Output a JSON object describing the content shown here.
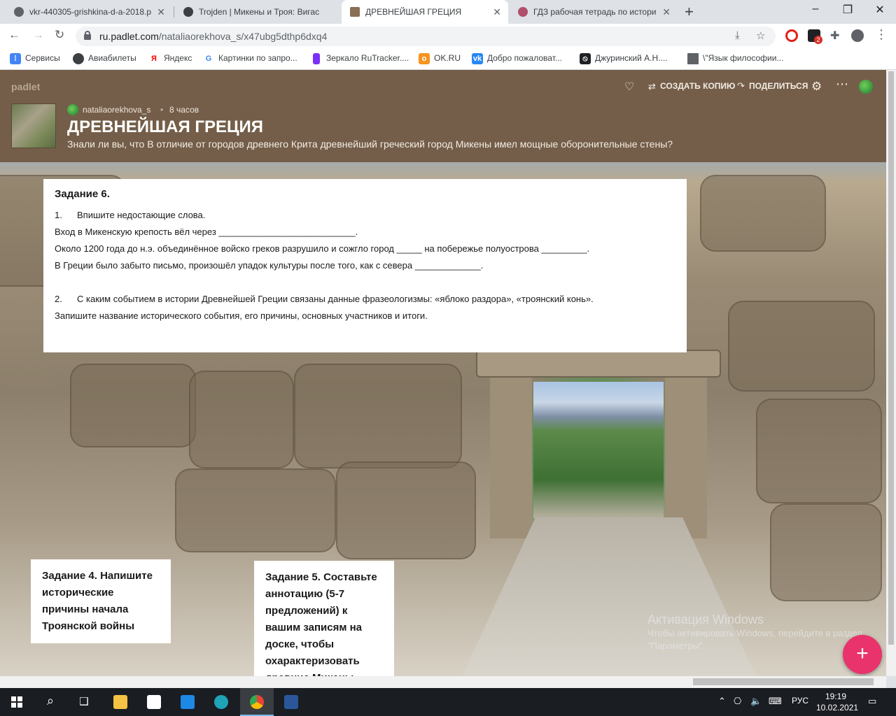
{
  "browser": {
    "tabs": [
      {
        "title": "vkr-440305-grishkina-d-a-2018.p",
        "favicon_color": "#5f6368",
        "active": false
      },
      {
        "title": "Trojden | Микены и Троя: Вигас",
        "favicon_color": "#3c4043",
        "active": false
      },
      {
        "title": "ДРЕВНЕЙШАЯ ГРЕЦИЯ",
        "favicon_color": "#8a6f55",
        "active": true
      },
      {
        "title": "ГДЗ рабочая тетрадь по истори",
        "favicon_color": "#b0506a",
        "active": false
      }
    ],
    "new_tab_glyph": "+",
    "window_controls": {
      "minimize": "–",
      "restore": "❐",
      "close": "✕"
    },
    "url_host": "ru.padlet.com",
    "url_path": "/nataliaorekhova_s/x47ubg5dthp6dxq4",
    "extension_badge": "2",
    "bookmarks": [
      {
        "label": "Сервисы",
        "icon": "apps-grid-icon",
        "color": "#4285f4"
      },
      {
        "label": "Авиабилеты",
        "icon": "globe-icon",
        "color": "#3c4043"
      },
      {
        "label": "Яндекс",
        "icon": "yandex-icon",
        "color": "#ff0000"
      },
      {
        "label": "Картинки по запро...",
        "icon": "google-icon",
        "color": "#4285f4"
      },
      {
        "label": "Зеркало RuTracker....",
        "icon": "rutracker-icon",
        "color": "#7b2ff7"
      },
      {
        "label": "OK.RU",
        "icon": "ok-icon",
        "color": "#f7931e"
      },
      {
        "label": "Добро пожаловат...",
        "icon": "vk-icon",
        "color": "#2787f5"
      },
      {
        "label": "Джуринский А.Н....",
        "icon": "nosign-icon",
        "color": "#202124"
      },
      {
        "label": "\\\"Язык философии...",
        "icon": "doc-icon",
        "color": "#5f6368"
      }
    ]
  },
  "padlet": {
    "brand": "padlet",
    "actions": {
      "copy": "СОЗДАТЬ КОПИЮ",
      "share": "ПОДЕЛИТЬСЯ"
    },
    "author": "nataliaorekhova_s",
    "separator": "•",
    "time_ago": "8 часов",
    "title": "ДРЕВНЕЙШАЯ ГРЕЦИЯ",
    "subtitle": "Знали ли вы, что В отличие от городов древнего Крита древнейший греческий город Микены имел мощные оборонительные стены?",
    "posts": {
      "task6": {
        "title": "Задание 6.",
        "q1_num": "1.",
        "q1_text": "Впишите недостающие слова.",
        "line1": "Вход в Микенскую крепость вёл через ___________________________.",
        "line2": "Около 1200 года до н.э. объединённое войско греков разрушило и сожгло город _____ на побережье полуострова _________.",
        "line3": "В Греции было забыто письмо, произошёл упадок культуры после того, как с севера _____________.",
        "q2_num": "2.",
        "q2_text": "С каким событием в истории Древнейшей Греции связаны данные фразеологизмы: «яблоко раздора», «троянский конь».",
        "line4": "Запишите название исторического события, его причины, основных участников и итоги."
      },
      "task4": {
        "title": "Задание 4. Напишите исторические причины начала Троянской войны"
      },
      "task5": {
        "title": "Задание 5. Составьте аннотацию (5-7 предложений) к вашим записям на доске, чтобы охарактеризовать древние Микены"
      }
    },
    "fab_label": "+",
    "accent_color": "#e8336c",
    "header_color": "#745e49"
  },
  "os_watermark": {
    "line1": "Активация Windows",
    "line2": "Чтобы активировать Windows, перейдите в раздел \"Параметры\"."
  },
  "taskbar": {
    "lang": "РУС",
    "time": "19:19",
    "date": "10.02.2021"
  }
}
